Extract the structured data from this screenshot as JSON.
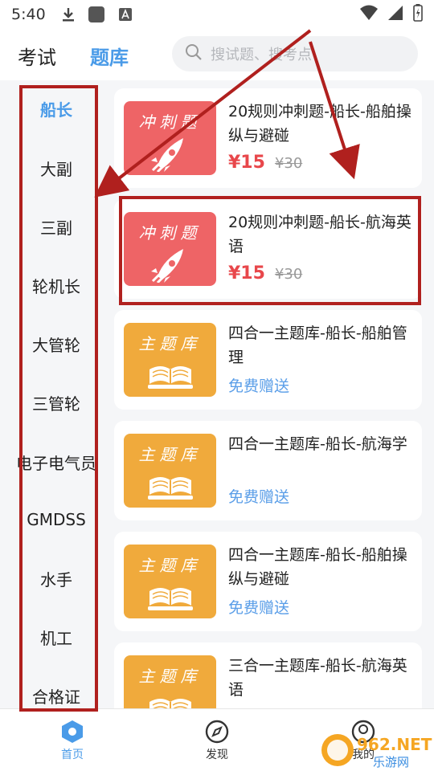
{
  "status": {
    "time": "5:40"
  },
  "header": {
    "tab_exam": "考试",
    "tab_bank": "题库",
    "search_placeholder": "搜试题、搜考点"
  },
  "sidebar": {
    "items": [
      {
        "label": "船长",
        "active": true
      },
      {
        "label": "大副"
      },
      {
        "label": "三副"
      },
      {
        "label": "轮机长"
      },
      {
        "label": "大管轮"
      },
      {
        "label": "三管轮"
      },
      {
        "label": "电子电气员"
      },
      {
        "label": "GMDSS"
      },
      {
        "label": "水手"
      },
      {
        "label": "机工"
      },
      {
        "label": "合格证"
      }
    ]
  },
  "cards": [
    {
      "thumb_label": "冲刺题",
      "thumb_type": "rocket",
      "title": "20规则冲刺题-船长-船舶操纵与避碰",
      "price": "¥15",
      "old_price": "¥30"
    },
    {
      "thumb_label": "冲刺题",
      "thumb_type": "rocket",
      "title": "20规则冲刺题-船长-航海英语",
      "price": "¥15",
      "old_price": "¥30"
    },
    {
      "thumb_label": "主题库",
      "thumb_type": "book",
      "title": "四合一主题库-船长-船舶管理",
      "free": "免费赠送"
    },
    {
      "thumb_label": "主题库",
      "thumb_type": "book",
      "title": "四合一主题库-船长-航海学",
      "free": "免费赠送"
    },
    {
      "thumb_label": "主题库",
      "thumb_type": "book",
      "title": "四合一主题库-船长-船舶操纵与避碰",
      "free": "免费赠送"
    },
    {
      "thumb_label": "主题库",
      "thumb_type": "book",
      "title": "三合一主题库-船长-航海英语"
    }
  ],
  "bottom_nav": [
    {
      "label": "首页",
      "icon": "home-icon",
      "active": true
    },
    {
      "label": "发现",
      "icon": "compass-icon"
    },
    {
      "label": "我的",
      "icon": "user-icon"
    }
  ],
  "watermark": {
    "brand": "962.NET",
    "sub": "乐游网"
  },
  "colors": {
    "accent": "#4a9be8",
    "price": "#e8474b",
    "annotation": "#b0201e",
    "thumb_red": "#ee6466",
    "thumb_orange": "#f0aa3c"
  }
}
